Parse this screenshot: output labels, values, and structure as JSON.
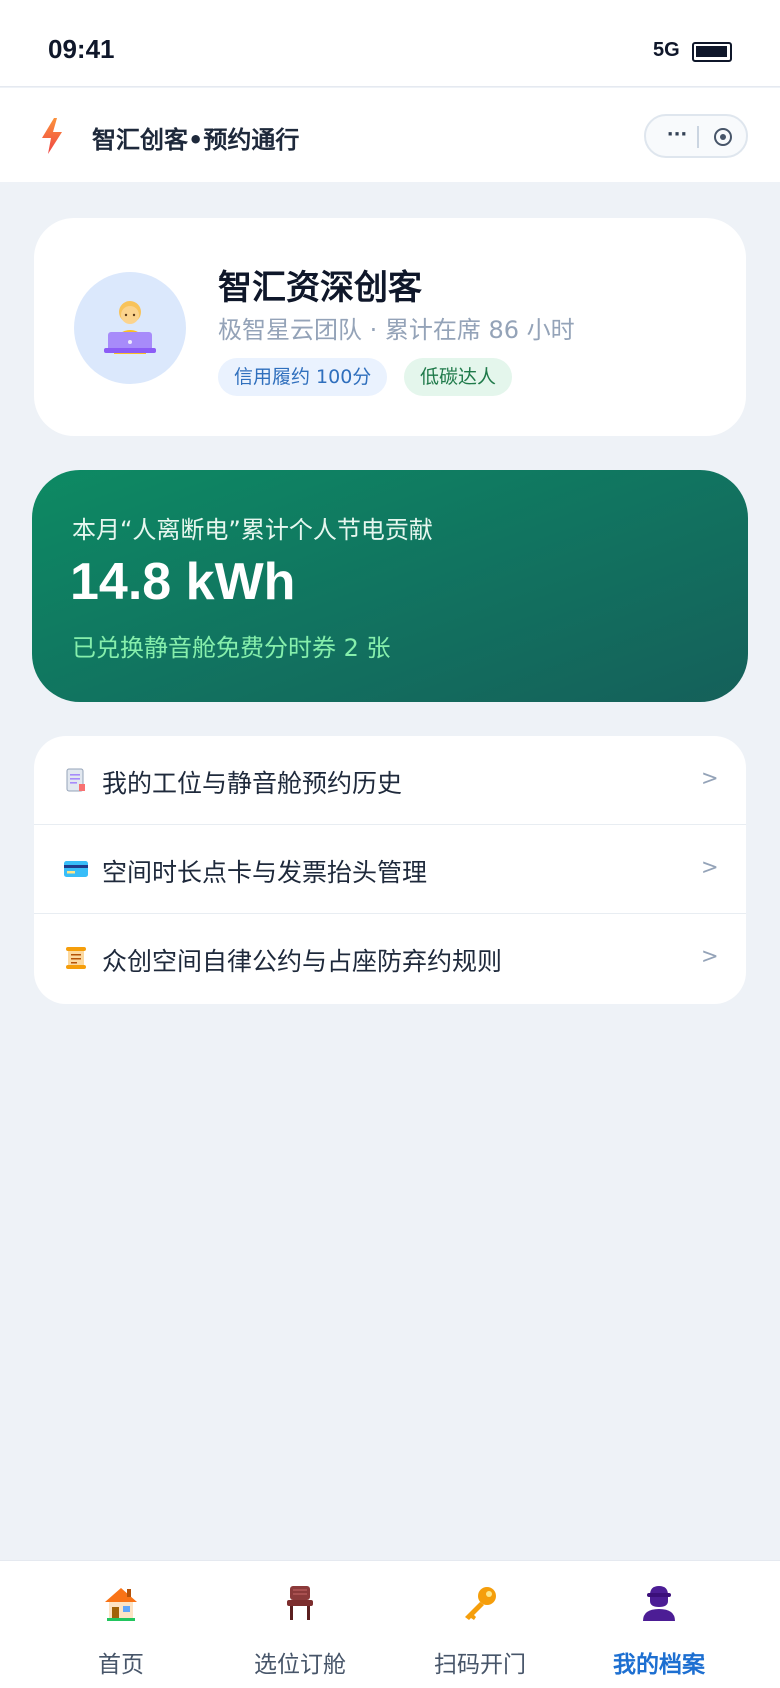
{
  "status_bar": {
    "time": "09:41",
    "network": "5G",
    "battery_level": 1.0
  },
  "header": {
    "title": "智汇创客•预约通行",
    "logo_icon": "lightning-icon",
    "more_label": "···",
    "accent": "#f97316"
  },
  "profile": {
    "avatar_icon": "person-laptop-icon",
    "name": "智汇资深创客",
    "subtitle": "极智星云团队 · 累计在席 86 小时",
    "badges": [
      {
        "label": "信用履约 100分",
        "color": "#2f6fbd"
      },
      {
        "label": "低碳达人",
        "color": "#1f7a4a"
      }
    ]
  },
  "energy": {
    "label": "本月“人离断电”累计个人节电贡献",
    "value": "14.8 kWh",
    "note": "已兑换静音舱免费分时券 2 张",
    "colors": [
      "#0d8a63",
      "#15605a"
    ]
  },
  "menu": {
    "items": [
      {
        "icon": "document-icon",
        "label": "我的工位与静音舱预约历史",
        "arrow": ">"
      },
      {
        "icon": "credit-card-icon",
        "label": "空间时长点卡与发票抬头管理",
        "arrow": ">"
      },
      {
        "icon": "scroll-icon",
        "label": "众创空间自律公约与占座防弃约规则",
        "arrow": ">"
      }
    ]
  },
  "tab_bar": {
    "active_color": "#1d6fd1",
    "tabs": [
      {
        "icon": "house-icon",
        "label": "首页",
        "active": false
      },
      {
        "icon": "chair-icon",
        "label": "选位订舱",
        "active": false
      },
      {
        "icon": "key-icon",
        "label": "扫码开门",
        "active": false
      },
      {
        "icon": "user-silhouette-icon",
        "label": "我的档案",
        "active": true
      }
    ]
  }
}
